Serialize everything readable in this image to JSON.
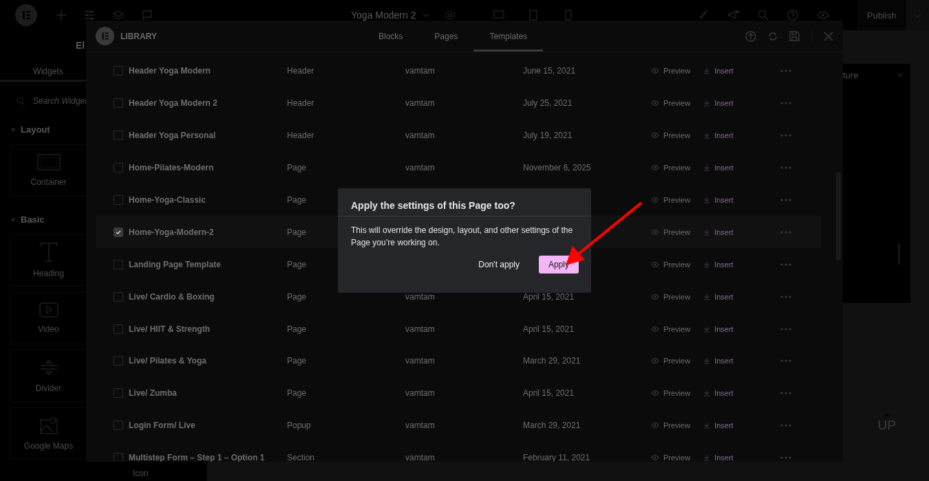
{
  "topbar": {
    "document_title": "Yoga Modern 2",
    "publish": "Publish"
  },
  "sidebar": {
    "title": "El",
    "tabs": [
      {
        "label": "Widgets",
        "selected": true
      }
    ],
    "search": {
      "placeholder": "Search Widget"
    },
    "sections": [
      {
        "title": "Layout",
        "expanded": true,
        "widgets": [
          {
            "label": "Container",
            "kind": "container"
          }
        ]
      },
      {
        "title": "Basic",
        "expanded": true,
        "widgets": [
          {
            "label": "Heading",
            "kind": "heading"
          },
          {
            "label": "Video",
            "kind": "video"
          },
          {
            "label": "Divider",
            "kind": "divider"
          },
          {
            "label": "Google Maps",
            "kind": "map"
          }
        ]
      }
    ],
    "next_column_label": "Icon"
  },
  "canvas": {
    "popup_title": "ture",
    "scroll_up": "UP"
  },
  "library": {
    "title": "LIBRARY",
    "tabs": [
      {
        "label": "Blocks",
        "selected": false
      },
      {
        "label": "Pages",
        "selected": false
      },
      {
        "label": "Templates",
        "selected": true
      }
    ],
    "rows": [
      {
        "name": "Header Yoga Modern",
        "type": "Header",
        "author": "vamtam",
        "date": "June 15, 2021",
        "checked": false,
        "preview": "Preview",
        "insert": "Insert"
      },
      {
        "name": "Header Yoga Modern 2",
        "type": "Header",
        "author": "vamtam",
        "date": "July 25, 2021",
        "checked": false,
        "preview": "Preview",
        "insert": "Insert"
      },
      {
        "name": "Header Yoga Personal",
        "type": "Header",
        "author": "vamtam",
        "date": "July 19, 2021",
        "checked": false,
        "preview": "Preview",
        "insert": "Insert"
      },
      {
        "name": "Home-Pilates-Modern",
        "type": "Page",
        "author": "vamtam",
        "date": "November 6, 2025",
        "checked": false,
        "preview": "Preview",
        "insert": "Insert"
      },
      {
        "name": "Home-Yoga-Classic",
        "type": "Page",
        "checked": false,
        "preview": "Preview",
        "insert": "Insert"
      },
      {
        "name": "Home-Yoga-Modern-2",
        "type": "Page",
        "checked": true,
        "preview": "Preview",
        "insert": "Insert"
      },
      {
        "name": "Landing Page Template",
        "type": "Page",
        "checked": false,
        "preview": "Preview",
        "insert": "Insert"
      },
      {
        "name": "Live/ Cardio & Boxing",
        "type": "Page",
        "author": "vamtam",
        "date": "April 15, 2021",
        "checked": false,
        "preview": "Preview",
        "insert": "Insert"
      },
      {
        "name": "Live/ HIIT & Strength",
        "type": "Page",
        "author": "vamtam",
        "date": "April 15, 2021",
        "checked": false,
        "preview": "Preview",
        "insert": "Insert"
      },
      {
        "name": "Live/ Pilates & Yoga",
        "type": "Page",
        "author": "vamtam",
        "date": "March 29, 2021",
        "checked": false,
        "preview": "Preview",
        "insert": "Insert"
      },
      {
        "name": "Live/ Zumba",
        "type": "Page",
        "author": "vamtam",
        "date": "April 15, 2021",
        "checked": false,
        "preview": "Preview",
        "insert": "Insert"
      },
      {
        "name": "Login Form/ Live",
        "type": "Popup",
        "author": "vamtam",
        "date": "March 29, 2021",
        "checked": false,
        "preview": "Preview",
        "insert": "Insert"
      },
      {
        "name": "Multistep Form – Step 1 – Option 1",
        "type": "Section",
        "author": "vamtam",
        "date": "February 11, 2021",
        "checked": false,
        "preview": "Preview",
        "insert": "Insert"
      }
    ]
  },
  "dialog": {
    "title": "Apply the settings of this Page too?",
    "message": "This will override the design, layout, and other settings of the Page you’re working on.",
    "buttons": [
      {
        "label": "Don't apply",
        "kind": "text"
      },
      {
        "label": "Apply",
        "kind": "primary"
      }
    ]
  }
}
